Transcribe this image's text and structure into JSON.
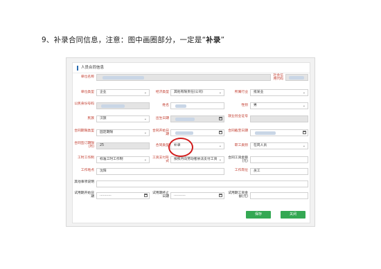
{
  "heading": {
    "prefix": "9、补录合同信息，注意：图中画圈部分，一定是“",
    "bold": "补录",
    "suffix": "”"
  },
  "panel": {
    "title": "人员合同信息"
  },
  "labels": {
    "unit_name": "单位名称",
    "credit_code": "社会信用代码",
    "unit_type": "单位类型",
    "econ_type": "经济类型",
    "industry": "所属行业",
    "id_number": "公民身份号码",
    "name": "姓名",
    "gender": "性别",
    "ethnicity": "民族",
    "birth_date": "出生日期",
    "employ_cert": "就业创业证号",
    "contract_term": "合同期限类型",
    "contract_start": "合同开始日期",
    "contract_end": "合同截至日期",
    "contract_months": "合同签订期限(月)",
    "contract_type": "合同类型",
    "job_category": "职工类别",
    "work_system": "工时工作制",
    "wage_form": "工资支付形式",
    "wage_amount": "合同工资金额(元)",
    "work_place": "工作地点",
    "job_post": "工作岗位",
    "other_items": "其他事项说明",
    "probation_start": "试用期开始日期",
    "probation_end": "试用期终止日期",
    "probation_wage": "试用期工资金额(元)"
  },
  "values": {
    "unit_type": "企业",
    "econ_type": "其他有限责任(公司)",
    "industry": "批发业",
    "gender": "男",
    "ethnicity": "汉族",
    "contract_term": "固定期限",
    "contract_months": "25",
    "contract_type": "补录",
    "job_category": "在岗人员",
    "work_system": "标准工时工作制",
    "wage_form": "按照月向劳动者依法支付工资",
    "work_place": "沈阳",
    "job_post": "员工",
    "date_placeholder": "..........."
  },
  "buttons": {
    "save": "保存",
    "close": "关闭"
  },
  "colors": {
    "required_label": "#c0392b",
    "button_green": "#34a853",
    "circle": "#d11b1b"
  }
}
